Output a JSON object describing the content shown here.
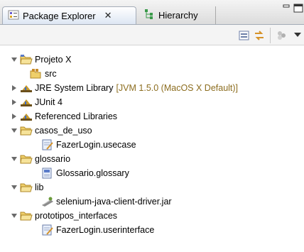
{
  "tabs": [
    {
      "label": "Package Explorer",
      "close": "✕"
    },
    {
      "label": "Hierarchy"
    }
  ],
  "tree": {
    "project": "Projeto X",
    "src": "src",
    "jre_library": "JRE System Library",
    "jre_decoration": "[JVM 1.5.0 (MacOS X Default)]",
    "junit": "JUnit 4",
    "referenced_libraries": "Referenced Libraries",
    "casos_de_uso": "casos_de_uso",
    "usecase_file": "FazerLogin.usecase",
    "glossario": "glossario",
    "glossary_file": "Glossario.glossary",
    "lib": "lib",
    "jar_file": "selenium-java-client-driver.jar",
    "prototipos": "prototipos_interfaces",
    "userinterface_file": "FazerLogin.userinterface"
  },
  "colors": {
    "folder": "#efcf6a",
    "library": "#c69a2b",
    "decoration": "#8c6d1f",
    "tab_border": "#a4acb8"
  }
}
